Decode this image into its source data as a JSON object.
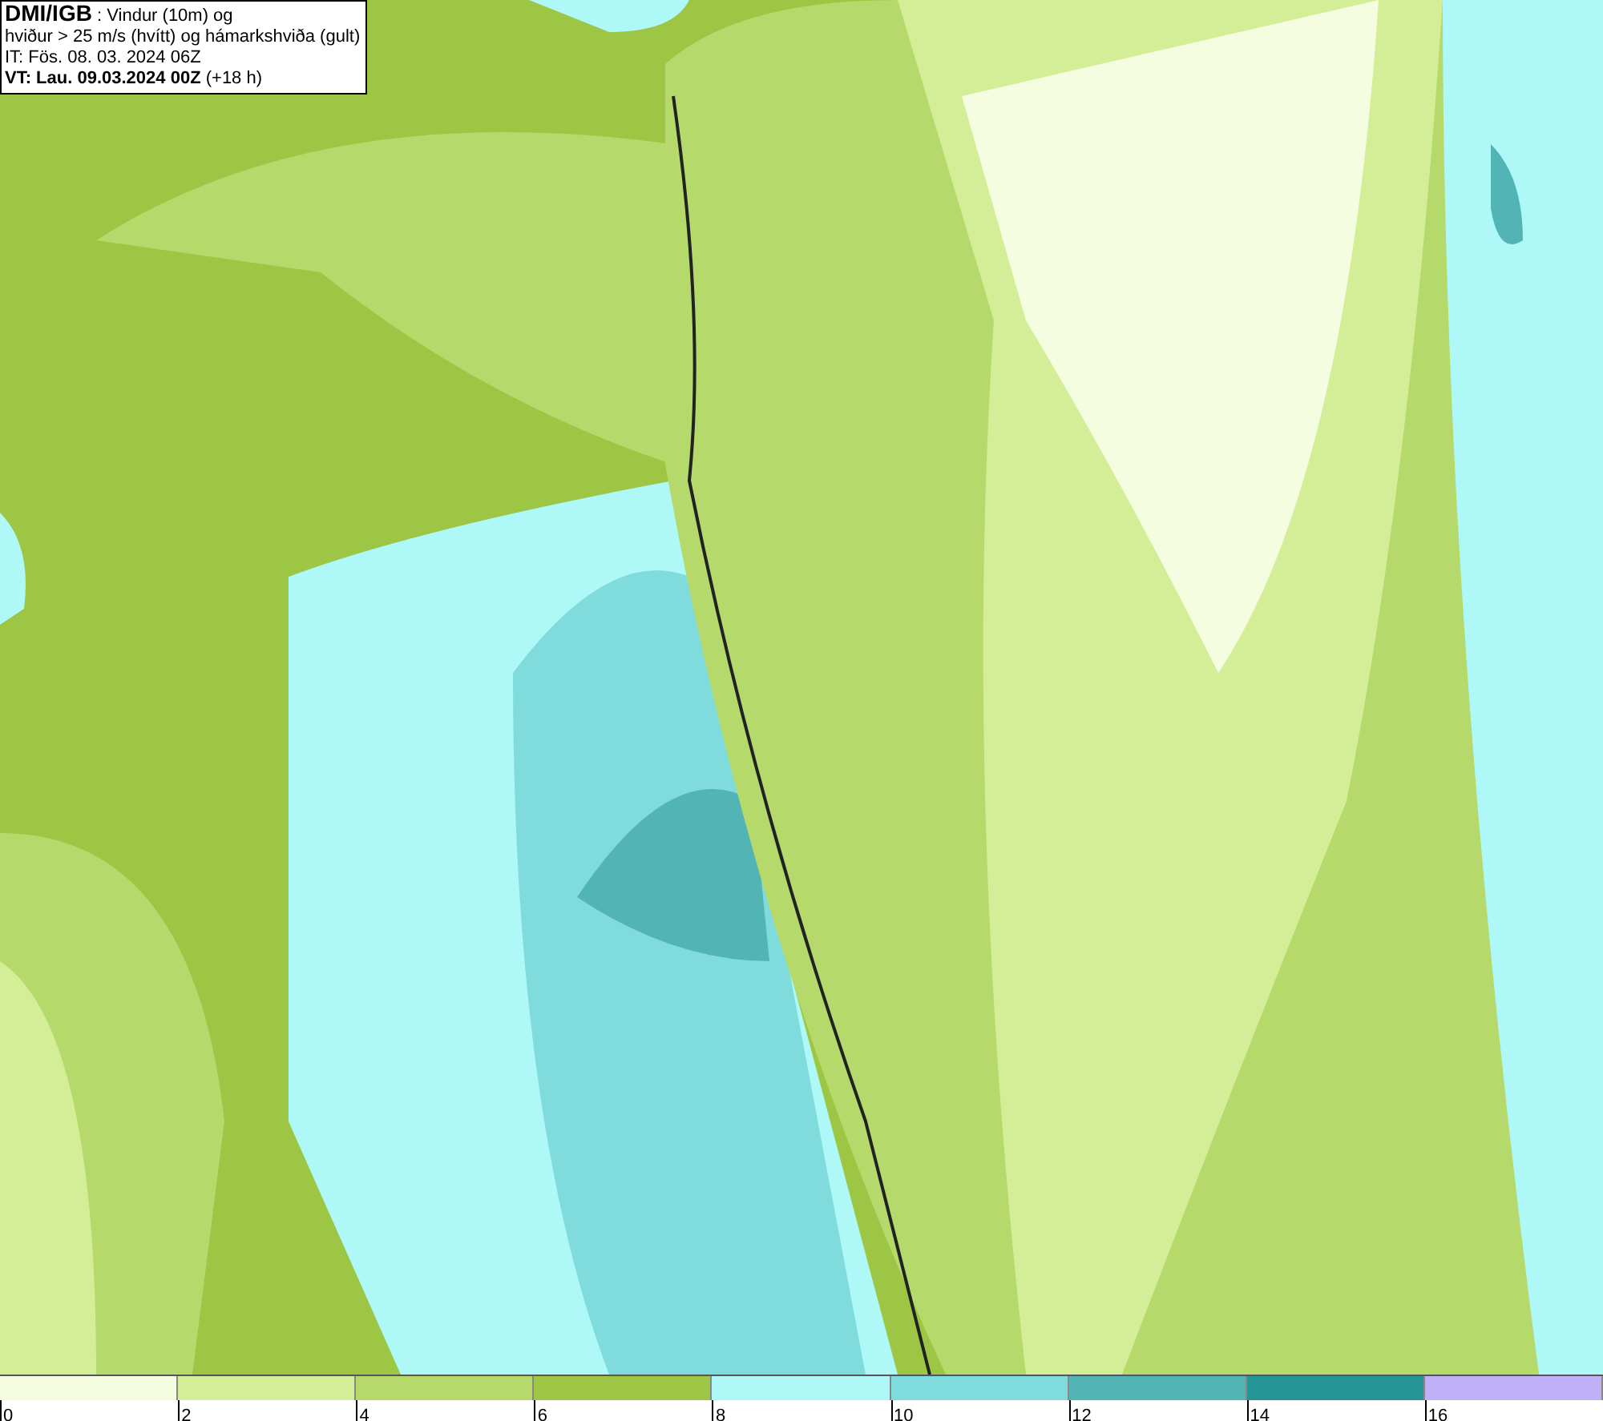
{
  "title_box": {
    "lines": [
      "**DMI/IGB** : Vindur (10m) og",
      "hviður > 25 m/s (hvítt) og hámarkshviða (gult)",
      "IT: Fös. 08. 03. 2024 06Z",
      "**VT: Lau. 09.03.2024 00Z** (+18 h)"
    ]
  },
  "legend": {
    "items": [
      {
        "label": "0",
        "color": "#f5fde0"
      },
      {
        "label": "2",
        "color": "#d4ee98"
      },
      {
        "label": "4",
        "color": "#b5d96a"
      },
      {
        "label": "6",
        "color": "#9cc644"
      },
      {
        "label": "8",
        "color": "#aef8f8"
      },
      {
        "label": "10",
        "color": "#80dcdc"
      },
      {
        "label": "12",
        "color": "#52b4b4"
      },
      {
        "label": "14",
        "color": "#249494"
      },
      {
        "label": "16",
        "color": "#c0b0f8"
      }
    ]
  }
}
